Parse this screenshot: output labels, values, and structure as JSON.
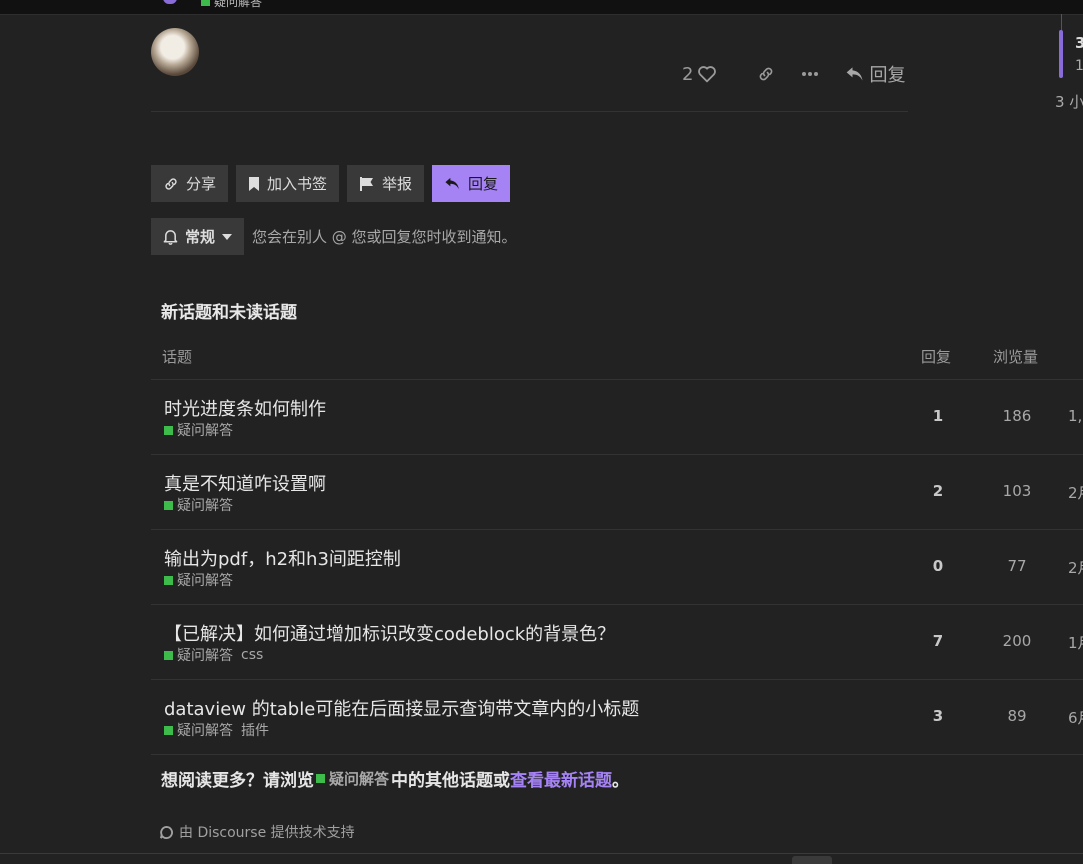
{
  "header": {
    "category": "疑问解答",
    "category_color": "#3dbb4b"
  },
  "post": {
    "like_count": "2",
    "reply_label": "回复"
  },
  "timeline": {
    "number": "3",
    "sub": "1",
    "time": "3 小"
  },
  "topic_buttons": {
    "share": "分享",
    "bookmark": "加入书签",
    "flag": "举报",
    "reply": "回复"
  },
  "notifications": {
    "level": "常规",
    "description": "您会在别人 @ 您或回复您时收到通知。"
  },
  "suggested": {
    "title": "新话题和未读话题",
    "columns": {
      "topic": "话题",
      "replies": "回复",
      "views": "浏览量"
    },
    "rows": [
      {
        "title": "时光进度条如何制作",
        "category": "疑问解答",
        "tags": "",
        "replies": "1",
        "views": "186",
        "activity": "1,"
      },
      {
        "title": "真是不知道咋设置啊",
        "category": "疑问解答",
        "tags": "",
        "replies": "2",
        "views": "103",
        "activity": "2月"
      },
      {
        "title": "输出为pdf，h2和h3间距控制",
        "category": "疑问解答",
        "tags": "",
        "replies": "0",
        "views": "77",
        "activity": "2月"
      },
      {
        "title": "【已解决】如何通过增加标识改变codeblock的背景色？",
        "category": "疑问解答",
        "tags": "css",
        "replies": "7",
        "views": "200",
        "activity": "1月"
      },
      {
        "title": "dataview 的table可能在后面接显示查询带文章内的小标题",
        "category": "疑问解答",
        "tags": "插件",
        "replies": "3",
        "views": "89",
        "activity": "6月"
      }
    ],
    "more_prefix": "想阅读更多？请浏览",
    "more_category": "疑问解答",
    "more_middle": "中的其他话题或",
    "more_latest": "查看最新话题",
    "more_suffix": "。"
  },
  "footer": {
    "powered_by": "由 Discourse 提供技术支持"
  },
  "colors": {
    "background": "#222222",
    "accent": "#a583f5",
    "category_green": "#3dbb4b"
  }
}
